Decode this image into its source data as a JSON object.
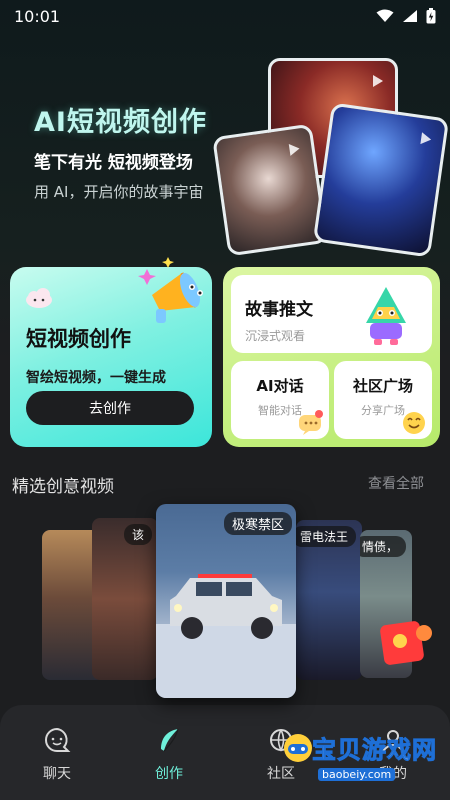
{
  "status_bar": {
    "time": "10:01"
  },
  "hero": {
    "title": "AI短视频创作",
    "subtitle": "笔下有光 短视频登场",
    "description": "用 AI，开启你的故事宇宙"
  },
  "features": {
    "primary": {
      "title": "短视频创作",
      "subtitle": "智绘短视频，一键生成",
      "button_label": "去创作"
    },
    "story": {
      "title": "故事推文",
      "subtitle": "沉浸式观看"
    },
    "ai_chat": {
      "title": "AI对话",
      "subtitle": "智能对话"
    },
    "community": {
      "title": "社区广场",
      "subtitle": "分享广场"
    }
  },
  "section": {
    "title": "精选创意视频",
    "more_label": "查看全部"
  },
  "videos": [
    {
      "label": ""
    },
    {
      "label": "该"
    },
    {
      "label": "极寒禁区"
    },
    {
      "label": "雷电法王"
    },
    {
      "label": "情债，"
    }
  ],
  "bottom_nav": [
    {
      "label": "聊天",
      "icon": "chat-icon"
    },
    {
      "label": "创作",
      "icon": "feather-icon"
    },
    {
      "label": "社区",
      "icon": "community-icon"
    },
    {
      "label": "我的",
      "icon": "profile-icon"
    }
  ],
  "watermark": {
    "text": "宝贝游戏网",
    "url": "baobeiy.com"
  },
  "colors": {
    "accent": "#6ff0da",
    "primary_card": "#7ff0e1",
    "secondary_panel": "#c8f08a",
    "background": "#1d1e20"
  }
}
